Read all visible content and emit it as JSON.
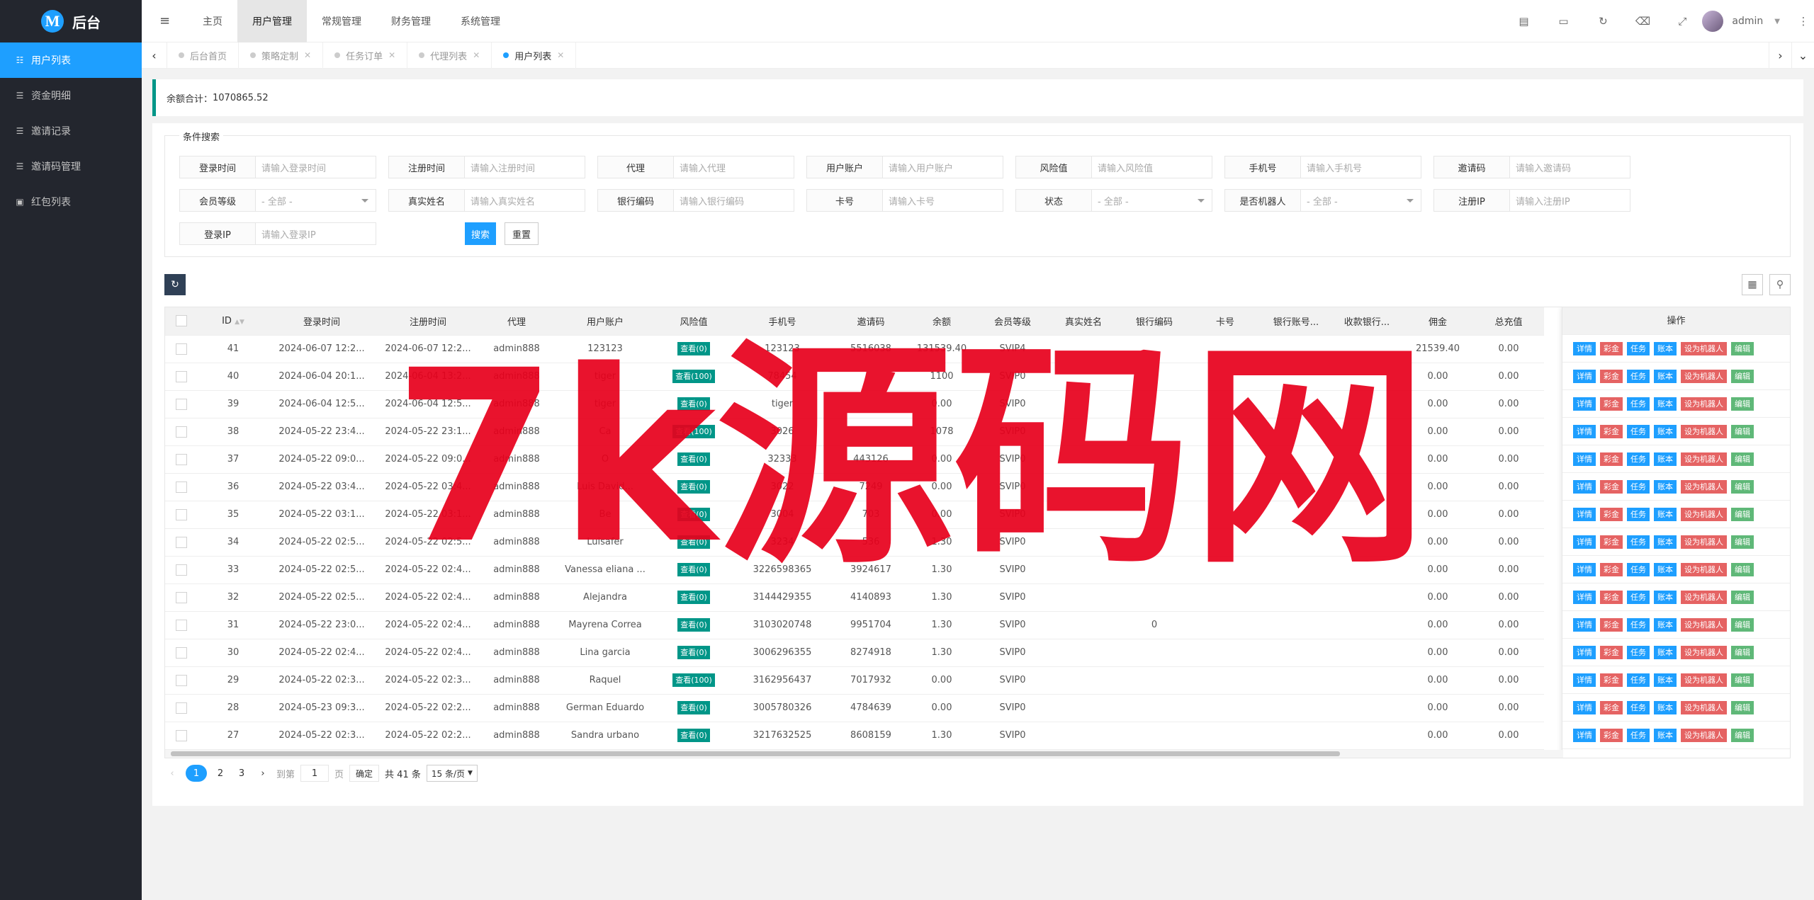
{
  "app": {
    "logo_letter": "M",
    "title": "后台"
  },
  "sidebar": {
    "items": [
      {
        "label": "用户列表",
        "icon": "users-icon",
        "active": true
      },
      {
        "label": "资金明细",
        "icon": "list-icon",
        "active": false
      },
      {
        "label": "邀请记录",
        "icon": "list-icon",
        "active": false
      },
      {
        "label": "邀请码管理",
        "icon": "list-icon",
        "active": false
      },
      {
        "label": "红包列表",
        "icon": "gift-icon",
        "active": false
      }
    ]
  },
  "header": {
    "nav": [
      "主页",
      "用户管理",
      "常规管理",
      "财务管理",
      "系统管理"
    ],
    "active_nav": "用户管理",
    "admin_name": "admin"
  },
  "tabs": [
    {
      "label": "后台首页",
      "active": false
    },
    {
      "label": "策略定制",
      "active": false
    },
    {
      "label": "任务订单",
      "active": false
    },
    {
      "label": "代理列表",
      "active": false
    },
    {
      "label": "用户列表",
      "active": true
    }
  ],
  "summary": {
    "label": "余额合计：",
    "value": "1070865.52"
  },
  "search": {
    "legend": "条件搜索",
    "rows": [
      [
        {
          "label": "登录时间",
          "placeholder": "请输入登录时间"
        },
        {
          "label": "注册时间",
          "placeholder": "请输入注册时间"
        },
        {
          "label": "代理",
          "placeholder": "请输入代理"
        },
        {
          "label": "用户账户",
          "placeholder": "请输入用户账户"
        },
        {
          "label": "风险值",
          "placeholder": "请输入风险值"
        },
        {
          "label": "手机号",
          "placeholder": "请输入手机号"
        },
        {
          "label": "邀请码",
          "placeholder": "请输入邀请码"
        }
      ],
      [
        {
          "label": "会员等级",
          "placeholder": "- 全部 -",
          "select": true
        },
        {
          "label": "真实姓名",
          "placeholder": "请输入真实姓名"
        },
        {
          "label": "银行编码",
          "placeholder": "请输入银行编码"
        },
        {
          "label": "卡号",
          "placeholder": "请输入卡号"
        },
        {
          "label": "状态",
          "placeholder": "- 全部 -",
          "select": true
        },
        {
          "label": "是否机器人",
          "placeholder": "- 全部 -",
          "select": true
        },
        {
          "label": "注册IP",
          "placeholder": "请输入注册IP"
        }
      ],
      [
        {
          "label": "登录IP",
          "placeholder": "请输入登录IP"
        }
      ]
    ],
    "search_btn": "搜索",
    "reset_btn": "重置"
  },
  "table": {
    "columns": [
      "ID",
      "登录时间",
      "注册时间",
      "代理",
      "用户账户",
      "风险值",
      "手机号",
      "邀请码",
      "余额",
      "会员等级",
      "真实姓名",
      "银行编码",
      "卡号",
      "银行账号...",
      "收款银行...",
      "佣金",
      "总充值"
    ],
    "ops_header": "操作",
    "ops": [
      "详情",
      "彩金",
      "任务",
      "账本",
      "设为机器人",
      "编辑"
    ],
    "rows": [
      {
        "id": "41",
        "login": "2024-06-07 12:2...",
        "reg": "2024-06-07 12:2...",
        "agent": "admin888",
        "account": "123123",
        "risk": "查看(0)",
        "phone": "123123",
        "code": "5516038",
        "balance": "131539.40",
        "level": "SVIP4",
        "bankcode": "",
        "commission": "21539.40",
        "recharge": "0.00"
      },
      {
        "id": "40",
        "login": "2024-06-04 20:1...",
        "reg": "2024-06-04 13:2...",
        "agent": "admin888",
        "account": "tiger",
        "risk": "查看(100)",
        "phone": "78454",
        "code": "",
        "balance": "1100",
        "level": "SVIP0",
        "bankcode": "",
        "commission": "0.00",
        "recharge": "0.00"
      },
      {
        "id": "39",
        "login": "2024-06-04 12:5...",
        "reg": "2024-06-04 12:5...",
        "agent": "admin888",
        "account": "tiger",
        "risk": "查看(0)",
        "phone": "tiger",
        "code": "",
        "balance": "0.00",
        "level": "SVIP0",
        "bankcode": "",
        "commission": "0.00",
        "recharge": "0.00"
      },
      {
        "id": "38",
        "login": "2024-05-22 23:4...",
        "reg": "2024-05-22 23:1...",
        "agent": "admin888",
        "account": "Ca",
        "risk": "查看(100)",
        "phone": "3026",
        "code": "",
        "balance": "1078",
        "level": "SVIP0",
        "bankcode": "",
        "commission": "0.00",
        "recharge": "0.00"
      },
      {
        "id": "37",
        "login": "2024-05-22 09:0...",
        "reg": "2024-05-22 09:0...",
        "agent": "admin888",
        "account": "O",
        "risk": "查看(0)",
        "phone": "32333",
        "code": "443126",
        "balance": "0.00",
        "level": "SVIP0",
        "bankcode": "",
        "commission": "0.00",
        "recharge": "0.00"
      },
      {
        "id": "36",
        "login": "2024-05-22 03:4...",
        "reg": "2024-05-22 03:4...",
        "agent": "admin888",
        "account": "Luis David...",
        "risk": "查看(0)",
        "phone": "3022",
        "code": "7249",
        "balance": "0.00",
        "level": "SVIP0",
        "bankcode": "",
        "commission": "0.00",
        "recharge": "0.00"
      },
      {
        "id": "35",
        "login": "2024-05-22 03:1...",
        "reg": "2024-05-22 03:1...",
        "agent": "admin888",
        "account": "Be",
        "risk": "查看(0)",
        "phone": "3004",
        "code": "703",
        "balance": "0.00",
        "level": "SVIP0",
        "bankcode": "",
        "commission": "0.00",
        "recharge": "0.00"
      },
      {
        "id": "34",
        "login": "2024-05-22 02:5...",
        "reg": "2024-05-22 02:5...",
        "agent": "admin888",
        "account": "Luisafer",
        "risk": "查看(0)",
        "phone": "3234",
        "code": "536",
        "balance": "1.30",
        "level": "SVIP0",
        "bankcode": "",
        "commission": "0.00",
        "recharge": "0.00"
      },
      {
        "id": "33",
        "login": "2024-05-22 02:5...",
        "reg": "2024-05-22 02:4...",
        "agent": "admin888",
        "account": "Vanessa eliana ...",
        "risk": "查看(0)",
        "phone": "3226598365",
        "code": "3924617",
        "balance": "1.30",
        "level": "SVIP0",
        "bankcode": "",
        "commission": "0.00",
        "recharge": "0.00"
      },
      {
        "id": "32",
        "login": "2024-05-22 02:5...",
        "reg": "2024-05-22 02:4...",
        "agent": "admin888",
        "account": "Alejandra",
        "risk": "查看(0)",
        "phone": "3144429355",
        "code": "4140893",
        "balance": "1.30",
        "level": "SVIP0",
        "bankcode": "",
        "commission": "0.00",
        "recharge": "0.00"
      },
      {
        "id": "31",
        "login": "2024-05-22 23:0...",
        "reg": "2024-05-22 02:4...",
        "agent": "admin888",
        "account": "Mayrena Correa",
        "risk": "查看(0)",
        "phone": "3103020748",
        "code": "9951704",
        "balance": "1.30",
        "level": "SVIP0",
        "bankcode": "0",
        "commission": "0.00",
        "recharge": "0.00"
      },
      {
        "id": "30",
        "login": "2024-05-22 02:4...",
        "reg": "2024-05-22 02:4...",
        "agent": "admin888",
        "account": "Lina garcia",
        "risk": "查看(0)",
        "phone": "3006296355",
        "code": "8274918",
        "balance": "1.30",
        "level": "SVIP0",
        "bankcode": "",
        "commission": "0.00",
        "recharge": "0.00"
      },
      {
        "id": "29",
        "login": "2024-05-22 02:3...",
        "reg": "2024-05-22 02:3...",
        "agent": "admin888",
        "account": "Raquel",
        "risk": "查看(100)",
        "phone": "3162956437",
        "code": "7017932",
        "balance": "0.00",
        "level": "SVIP0",
        "bankcode": "",
        "commission": "0.00",
        "recharge": "0.00"
      },
      {
        "id": "28",
        "login": "2024-05-23 09:3...",
        "reg": "2024-05-22 02:2...",
        "agent": "admin888",
        "account": "German Eduardo",
        "risk": "查看(0)",
        "phone": "3005780326",
        "code": "4784639",
        "balance": "0.00",
        "level": "SVIP0",
        "bankcode": "",
        "commission": "0.00",
        "recharge": "0.00"
      },
      {
        "id": "27",
        "login": "2024-05-22 02:3...",
        "reg": "2024-05-22 02:2...",
        "agent": "admin888",
        "account": "Sandra urbano",
        "risk": "查看(0)",
        "phone": "3217632525",
        "code": "8608159",
        "balance": "1.30",
        "level": "SVIP0",
        "bankcode": "",
        "commission": "0.00",
        "recharge": "0.00"
      }
    ]
  },
  "pager": {
    "pages": [
      "1",
      "2",
      "3"
    ],
    "goto_label": "到第",
    "goto_value": "1",
    "page_unit": "页",
    "confirm": "确定",
    "total": "共 41 条",
    "per_page": "15 条/页"
  },
  "watermark": {
    "text": "7k源码网",
    "color": "#e8001c"
  },
  "colors": {
    "accent": "#1e9fff",
    "sidebar": "#23262e",
    "teal": "#009688",
    "danger": "#e56363",
    "success": "#5fb878"
  }
}
